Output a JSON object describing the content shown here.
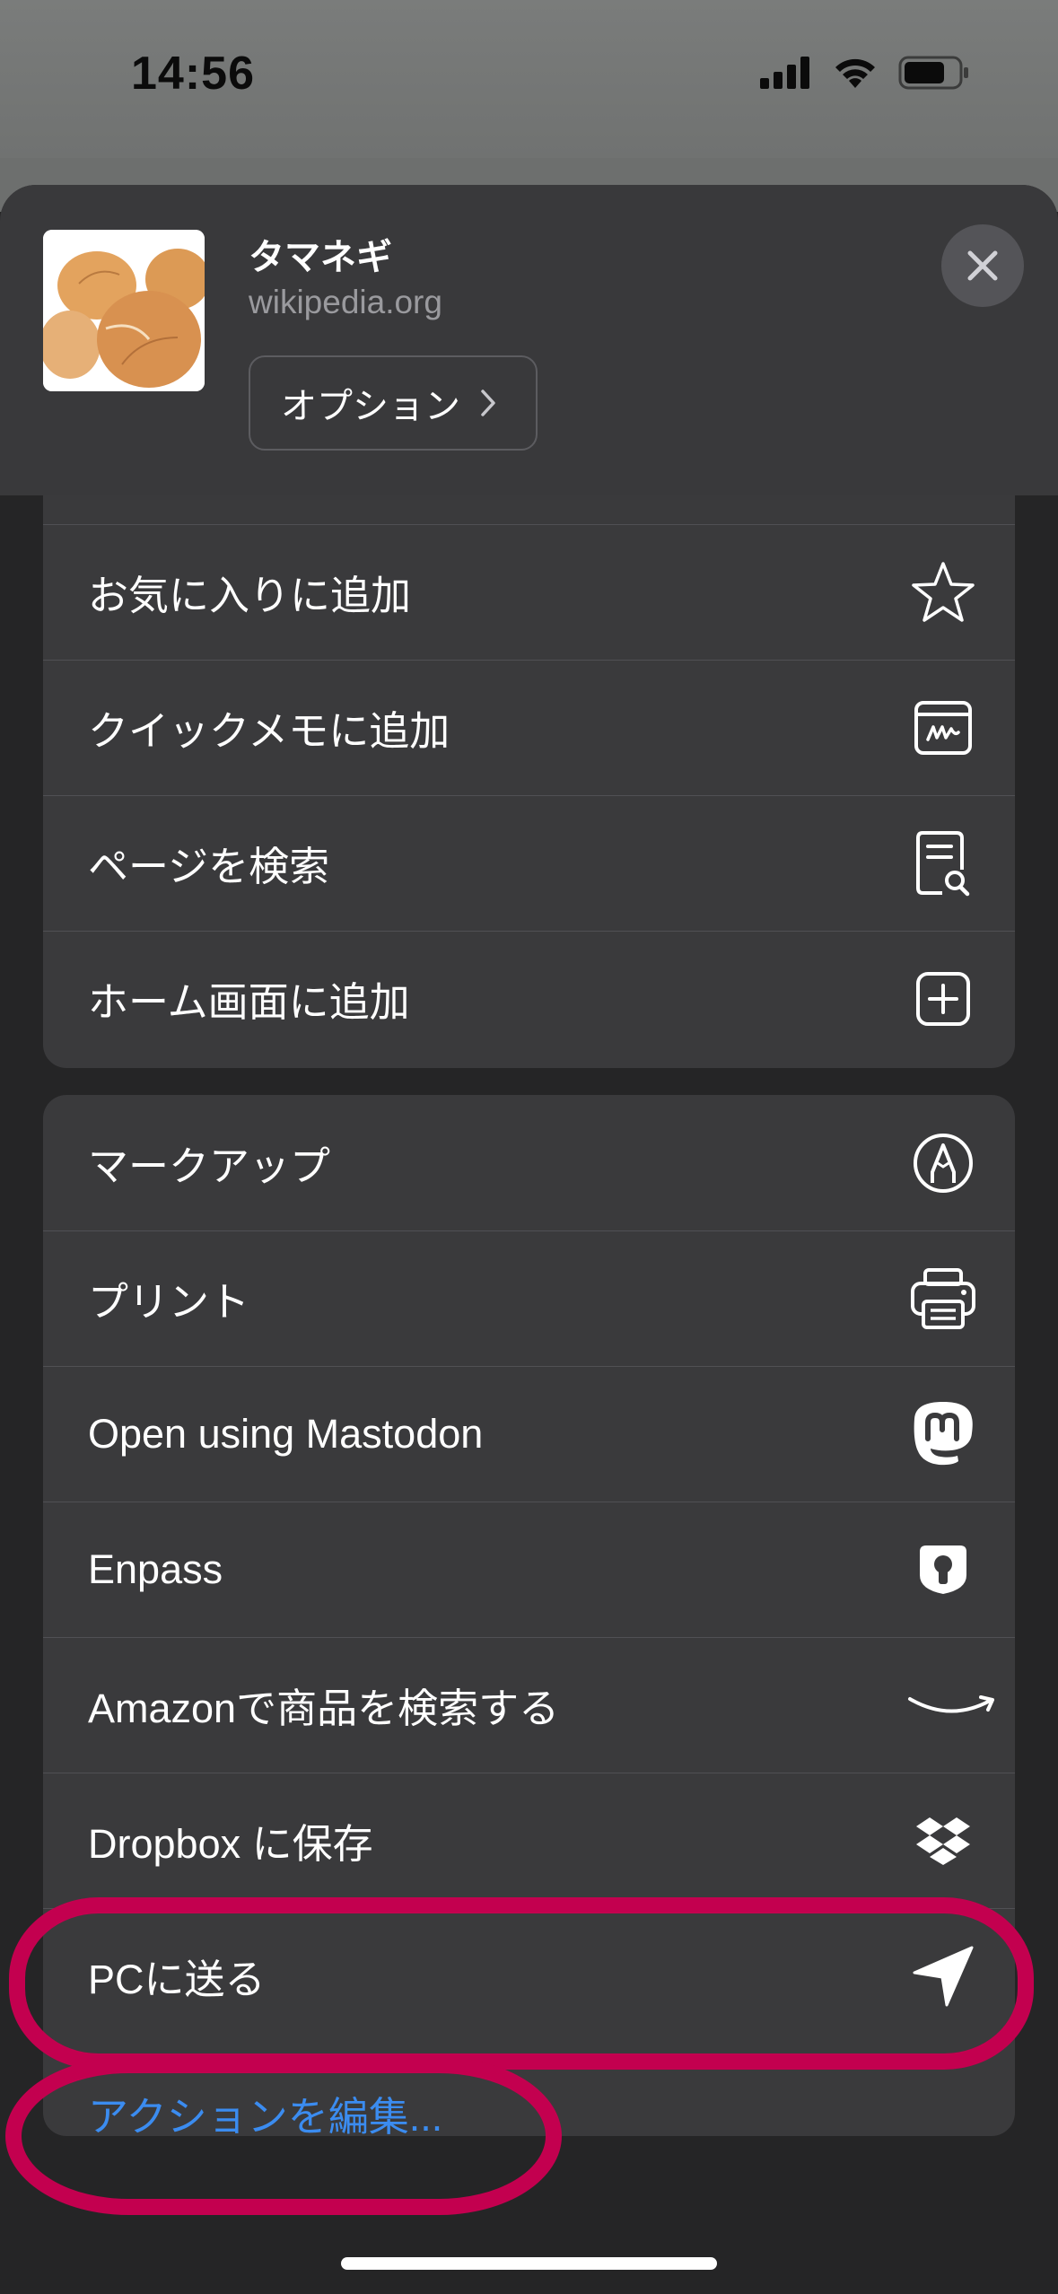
{
  "status_bar": {
    "time": "14:56"
  },
  "share_header": {
    "title": "タマネギ",
    "url": "wikipedia.org",
    "options_label": "オプション"
  },
  "group1": [
    {
      "label": "お気に入りに追加",
      "icon": "star-icon"
    },
    {
      "label": "クイックメモに追加",
      "icon": "quick-note-icon"
    },
    {
      "label": "ページを検索",
      "icon": "find-on-page-icon"
    },
    {
      "label": "ホーム画面に追加",
      "icon": "add-square-icon"
    }
  ],
  "group2": [
    {
      "label": "マークアップ",
      "icon": "markup-pen-icon"
    },
    {
      "label": "プリント",
      "icon": "printer-icon"
    },
    {
      "label": "Open using Mastodon",
      "icon": "mastodon-icon"
    },
    {
      "label": "Enpass",
      "icon": "enpass-icon"
    },
    {
      "label": "Amazonで商品を検索する",
      "icon": "amazon-smile-icon"
    },
    {
      "label": "Dropbox に保存",
      "icon": "dropbox-icon"
    },
    {
      "label": "PCに送る",
      "icon": "send-arrow-icon"
    }
  ],
  "edit_actions_label": "アクションを編集...",
  "colors": {
    "accent": "#3b8cf0",
    "annotation": "#c3004f",
    "sheet": "#252526",
    "row_bg": "#3a3a3c"
  }
}
